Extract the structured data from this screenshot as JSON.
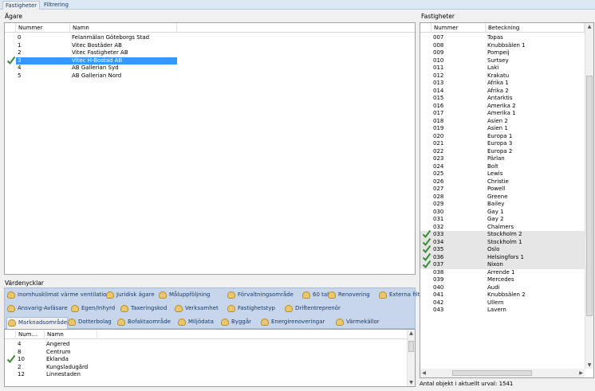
{
  "tabs": [
    {
      "label": "Fastigheter",
      "active": true
    },
    {
      "label": "Filtrering",
      "active": false
    }
  ],
  "agare": {
    "title": "Ägare",
    "columns": [
      "Nummer",
      "Namn"
    ],
    "rows": [
      {
        "num": "0",
        "name": "Felanmälan Göteborgs Stad",
        "checked": false,
        "selected": false
      },
      {
        "num": "1",
        "name": "Vitec Bostäder AB",
        "checked": false,
        "selected": false
      },
      {
        "num": "2",
        "name": "Vitec Fastigheter AB",
        "checked": false,
        "selected": false
      },
      {
        "num": "3",
        "name": "Vitec H-Bostad AB",
        "checked": true,
        "selected": true
      },
      {
        "num": "4",
        "name": "AB Gallerian Syd",
        "checked": false,
        "selected": false
      },
      {
        "num": "5",
        "name": "AB Gallerian Nord",
        "checked": false,
        "selected": false
      }
    ]
  },
  "vardenycklar": {
    "title": "Värdenycklar",
    "row1": [
      "Inomhusklimat värme ventilation",
      "Juridisk ägare",
      "Måluppföljning",
      "Förvaltningsområde",
      "60 tal",
      "Renovering",
      "Externa filter"
    ],
    "row2": [
      "Ansvarig-Avläsare",
      "Egen/Inhyrd",
      "Taxeringskod",
      "Verksamhet",
      "Fastighetstyp",
      "Driftentreprenör"
    ],
    "row3": [
      "Marknadsområde",
      "Dotterbolag",
      "Bofaktaområde",
      "Miljödata",
      "Byggår",
      "Energirenoveringar",
      "Värmekällor"
    ],
    "active_tab": "Marknadsområde",
    "columns": [
      "Num...",
      "Namn"
    ],
    "rows": [
      {
        "num": "4",
        "name": "Angered",
        "checked": false
      },
      {
        "num": "8",
        "name": "Centrum",
        "checked": false
      },
      {
        "num": "10",
        "name": "Eklanda",
        "checked": true
      },
      {
        "num": "2",
        "name": "Kungsladugård",
        "checked": false
      },
      {
        "num": "12",
        "name": "Linnestaden",
        "checked": false
      }
    ]
  },
  "fastigheter": {
    "title": "Fastigheter",
    "columns": [
      "Nummer",
      "Beteckning"
    ],
    "rows": [
      {
        "num": "007",
        "name": "Topas",
        "checked": false
      },
      {
        "num": "008",
        "name": "Knubbsälen 1",
        "checked": false
      },
      {
        "num": "009",
        "name": "Pompeij",
        "checked": false
      },
      {
        "num": "010",
        "name": "Surtsey",
        "checked": false
      },
      {
        "num": "011",
        "name": "Laki",
        "checked": false
      },
      {
        "num": "012",
        "name": "Krakatu",
        "checked": false
      },
      {
        "num": "013",
        "name": "Afrika 1",
        "checked": false
      },
      {
        "num": "014",
        "name": "Afrika 2",
        "checked": false
      },
      {
        "num": "015",
        "name": "Antarktis",
        "checked": false
      },
      {
        "num": "016",
        "name": "Amerika 2",
        "checked": false
      },
      {
        "num": "017",
        "name": "Amerika 1",
        "checked": false
      },
      {
        "num": "018",
        "name": "Asien 2",
        "checked": false
      },
      {
        "num": "019",
        "name": "Asien 1",
        "checked": false
      },
      {
        "num": "020",
        "name": "Europa 1",
        "checked": false
      },
      {
        "num": "021",
        "name": "Europa 3",
        "checked": false
      },
      {
        "num": "022",
        "name": "Europa 2",
        "checked": false
      },
      {
        "num": "023",
        "name": "Pärlan",
        "checked": false
      },
      {
        "num": "024",
        "name": "Bolt",
        "checked": false
      },
      {
        "num": "025",
        "name": "Lewis",
        "checked": false
      },
      {
        "num": "026",
        "name": "Christie",
        "checked": false
      },
      {
        "num": "027",
        "name": "Powell",
        "checked": false
      },
      {
        "num": "028",
        "name": "Greene",
        "checked": false
      },
      {
        "num": "029",
        "name": "Bailey",
        "checked": false
      },
      {
        "num": "030",
        "name": "Gay 1",
        "checked": false
      },
      {
        "num": "031",
        "name": "Gay 2",
        "checked": false
      },
      {
        "num": "032",
        "name": "Chalmers",
        "checked": false
      },
      {
        "num": "033",
        "name": "Stockholm 2",
        "checked": true
      },
      {
        "num": "034",
        "name": "Stockholm 1",
        "checked": true
      },
      {
        "num": "035",
        "name": "Oslo",
        "checked": true
      },
      {
        "num": "036",
        "name": "Helsingfors 1",
        "checked": true
      },
      {
        "num": "037",
        "name": "Nixon",
        "checked": true
      },
      {
        "num": "038",
        "name": "Arrende 1",
        "checked": false
      },
      {
        "num": "039",
        "name": "Mercedes",
        "checked": false
      },
      {
        "num": "040",
        "name": "Audi",
        "checked": false
      },
      {
        "num": "041",
        "name": "Knubbsälen 2",
        "checked": false
      },
      {
        "num": "042",
        "name": "Ullern",
        "checked": false
      },
      {
        "num": "043",
        "name": "Lavern",
        "checked": false
      }
    ]
  },
  "status": {
    "text": "Antal objekt i aktuellt urval: 1541"
  },
  "colors": {
    "selection": "#3399ff",
    "check": "#3a8a3a",
    "panel": "#c7d6ea"
  }
}
